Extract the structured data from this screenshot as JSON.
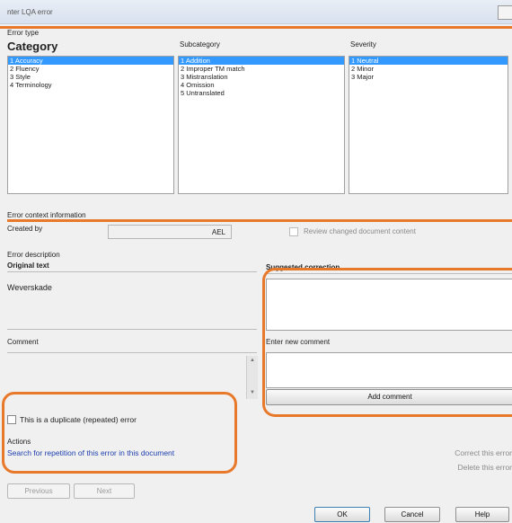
{
  "window": {
    "title": "nter LQA error",
    "close_label": ""
  },
  "error_type": {
    "group_label": "Error type",
    "category_label": "Category",
    "subcategory_label": "Subcategory",
    "severity_label": "Severity",
    "categories": [
      "1 Accuracy",
      "2 Fluency",
      "3 Style",
      "4 Terminology"
    ],
    "subcategories": [
      "1 Addition",
      "2 Improper TM match",
      "3 Mistranslation",
      "4 Omission",
      "5 Untranslated"
    ],
    "severities": [
      "1 Neutral",
      "2 Minor",
      "3 Major"
    ]
  },
  "context": {
    "group_label": "Error context information",
    "created_by_label": "Created by",
    "created_by_value": "AEL",
    "review_label": "Review changed document content"
  },
  "description": {
    "group_label": "Error description",
    "original_label": "Original text",
    "original_value": "Weverskade",
    "suggested_label": "Suggested correction",
    "comment_label": "Comment",
    "new_comment_label": "Enter new comment",
    "add_comment_label": "Add comment"
  },
  "duplicate_label": "This is a duplicate (repeated) error",
  "actions": {
    "label": "Actions",
    "search_link": "Search for repetition of this error in this document",
    "correct_label": "Correct this error",
    "delete_label": "Delete this error"
  },
  "nav": {
    "previous": "Previous",
    "next": "Next"
  },
  "footer": {
    "ok": "OK",
    "cancel": "Cancel",
    "help": "Help"
  },
  "colors": {
    "highlight": "#e8782a",
    "selection": "#3399ff",
    "link": "#1f3fae"
  }
}
